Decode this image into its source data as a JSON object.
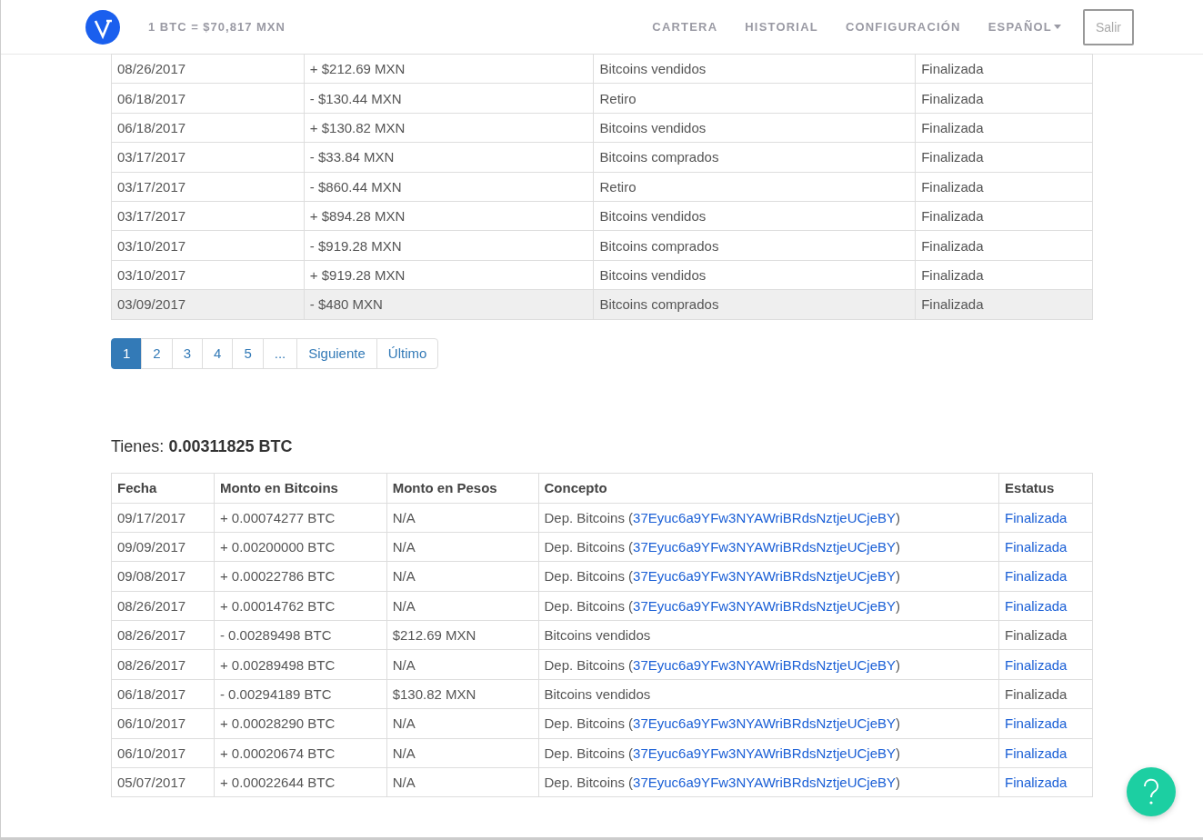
{
  "navbar": {
    "rate": "1 BTC = $70,817 MXN",
    "links": [
      {
        "label": "CARTERA",
        "dropdown": false
      },
      {
        "label": "HISTORIAL",
        "dropdown": false
      },
      {
        "label": "CONFIGURACIÓN",
        "dropdown": false
      },
      {
        "label": "ESPAÑOL",
        "dropdown": true
      }
    ],
    "logout": "Salir"
  },
  "pesos_table": {
    "rows": [
      {
        "date": "08/26/2017",
        "amount": "+ $212.69 MXN",
        "concept": "Bitcoins vendidos",
        "status": "Finalizada",
        "selected": false
      },
      {
        "date": "06/18/2017",
        "amount": "- $130.44 MXN",
        "concept": "Retiro",
        "status": "Finalizada",
        "selected": false
      },
      {
        "date": "06/18/2017",
        "amount": "+ $130.82 MXN",
        "concept": "Bitcoins vendidos",
        "status": "Finalizada",
        "selected": false
      },
      {
        "date": "03/17/2017",
        "amount": "- $33.84 MXN",
        "concept": "Bitcoins comprados",
        "status": "Finalizada",
        "selected": false
      },
      {
        "date": "03/17/2017",
        "amount": "- $860.44 MXN",
        "concept": "Retiro",
        "status": "Finalizada",
        "selected": false
      },
      {
        "date": "03/17/2017",
        "amount": "+ $894.28 MXN",
        "concept": "Bitcoins vendidos",
        "status": "Finalizada",
        "selected": false
      },
      {
        "date": "03/10/2017",
        "amount": "- $919.28 MXN",
        "concept": "Bitcoins comprados",
        "status": "Finalizada",
        "selected": false
      },
      {
        "date": "03/10/2017",
        "amount": "+ $919.28 MXN",
        "concept": "Bitcoins vendidos",
        "status": "Finalizada",
        "selected": false
      },
      {
        "date": "03/09/2017",
        "amount": "- $480 MXN",
        "concept": "Bitcoins comprados",
        "status": "Finalizada",
        "selected": true
      }
    ]
  },
  "pagination": [
    {
      "label": "1",
      "selected": true
    },
    {
      "label": "2",
      "selected": false
    },
    {
      "label": "3",
      "selected": false
    },
    {
      "label": "4",
      "selected": false
    },
    {
      "label": "5",
      "selected": false
    },
    {
      "label": "...",
      "selected": false
    },
    {
      "label": "Siguiente",
      "selected": false
    },
    {
      "label": "Último",
      "selected": false
    }
  ],
  "balance": "Tienes: **0.00311825 BTC**",
  "bitcoin_table": {
    "columns": [
      "Fecha",
      "Monto en Bitcoins",
      "Monto en Pesos",
      "Concepto",
      "Estatus"
    ],
    "rows": [
      {
        "date": "09/17/2017",
        "btc": "+ 0.00074277 BTC",
        "pesos": "N/A",
        "concept": "Dep. Bitcoins (",
        "address": "37Eyuc6a9YFw3NYAWriBRdsNztjeUCjeBY",
        "close": ")",
        "status": "Finalizada",
        "status_link": true
      },
      {
        "date": "09/09/2017",
        "btc": "+ 0.00200000 BTC",
        "pesos": "N/A",
        "concept": "Dep. Bitcoins (",
        "address": "37Eyuc6a9YFw3NYAWriBRdsNztjeUCjeBY",
        "close": ")",
        "status": "Finalizada",
        "status_link": true
      },
      {
        "date": "09/08/2017",
        "btc": "+ 0.00022786 BTC",
        "pesos": "N/A",
        "concept": "Dep. Bitcoins (",
        "address": "37Eyuc6a9YFw3NYAWriBRdsNztjeUCjeBY",
        "close": ")",
        "status": "Finalizada",
        "status_link": true
      },
      {
        "date": "08/26/2017",
        "btc": "+ 0.00014762 BTC",
        "pesos": "N/A",
        "concept": "Dep. Bitcoins (",
        "address": "37Eyuc6a9YFw3NYAWriBRdsNztjeUCjeBY",
        "close": ")",
        "status": "Finalizada",
        "status_link": true
      },
      {
        "date": "08/26/2017",
        "btc": "- 0.00289498 BTC",
        "pesos": "$212.69 MXN",
        "concept": "Bitcoins vendidos",
        "status": "Finalizada",
        "status_link": false
      },
      {
        "date": "08/26/2017",
        "btc": "+ 0.00289498 BTC",
        "pesos": "N/A",
        "concept": "Dep. Bitcoins (",
        "address": "37Eyuc6a9YFw3NYAWriBRdsNztjeUCjeBY",
        "close": ")",
        "status": "Finalizada",
        "status_link": true
      },
      {
        "date": "06/18/2017",
        "btc": "- 0.00294189 BTC",
        "pesos": "$130.82 MXN",
        "concept": "Bitcoins vendidos",
        "status": "Finalizada",
        "status_link": false
      },
      {
        "date": "06/10/2017",
        "btc": "+ 0.00028290 BTC",
        "pesos": "N/A",
        "concept": "Dep. Bitcoins (",
        "address": "37Eyuc6a9YFw3NYAWriBRdsNztjeUCjeBY",
        "close": ")",
        "status": "Finalizada",
        "status_link": true
      },
      {
        "date": "06/10/2017",
        "btc": "+ 0.00020674 BTC",
        "pesos": "N/A",
        "concept": "Dep. Bitcoins (",
        "address": "37Eyuc6a9YFw3NYAWriBRdsNztjeUCjeBY",
        "close": ")",
        "status": "Finalizada",
        "status_link": true
      },
      {
        "date": "05/07/2017",
        "btc": "+ 0.00022644 BTC",
        "pesos": "N/A",
        "concept": "Dep. Bitcoins (",
        "address": "37Eyuc6a9YFw3NYAWriBRdsNztjeUCjeBY",
        "close": ")",
        "status": "Finalizada",
        "status_link": true
      }
    ]
  }
}
